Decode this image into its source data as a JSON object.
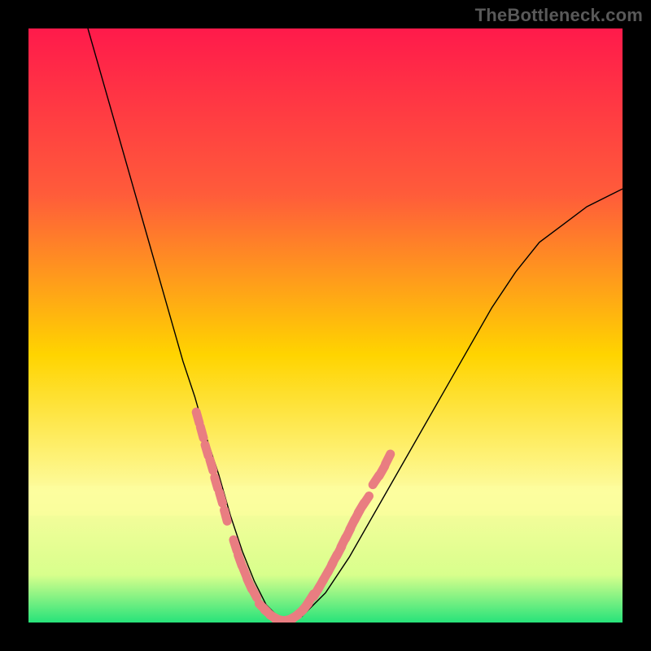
{
  "watermark": "TheBottleneck.com",
  "chart_data": {
    "type": "line",
    "title": "",
    "xlabel": "",
    "ylabel": "",
    "xlim": [
      0,
      100
    ],
    "ylim": [
      0,
      100
    ],
    "legend": false,
    "grid": false,
    "background_gradient": {
      "top_color": "#ff1a4b",
      "mid_color": "#ffd400",
      "lower_color": "#fdfc9f",
      "bottom_color": "#27e37a"
    },
    "series": [
      {
        "name": "bottleneck-curve",
        "color": "#000000",
        "width": 1.4,
        "x": [
          10,
          12,
          14,
          16,
          18,
          20,
          22,
          24,
          26,
          28,
          30,
          32,
          34,
          36,
          38,
          40,
          42,
          44,
          46,
          50,
          54,
          58,
          62,
          66,
          70,
          74,
          78,
          82,
          86,
          90,
          94,
          98,
          100
        ],
        "values": [
          100,
          93,
          86,
          79,
          72,
          65,
          58,
          51,
          44,
          38,
          31,
          25,
          18,
          12,
          7,
          3,
          1,
          0,
          1,
          5,
          11,
          18,
          25,
          32,
          39,
          46,
          53,
          59,
          64,
          67,
          70,
          72,
          73
        ]
      }
    ],
    "marker_segments": [
      {
        "name": "left-upper-dots",
        "color": "#e97d81",
        "x": [
          28.5,
          29.2,
          30.0,
          30.8,
          31.6,
          32.4,
          33.2
        ],
        "values": [
          34.5,
          32.0,
          29.0,
          26.5,
          23.5,
          21.0,
          18.0
        ]
      },
      {
        "name": "left-lower-dots",
        "color": "#e97d81",
        "x": [
          34.8,
          35.6,
          36.4,
          37.2,
          38.0
        ],
        "values": [
          13.0,
          10.5,
          8.5,
          6.5,
          5.0
        ]
      },
      {
        "name": "base-dots",
        "color": "#e97d81",
        "x": [
          39.5,
          40.5,
          41.5,
          42.5,
          43.5,
          44.5,
          45.5,
          46.5,
          47.0,
          47.5
        ],
        "values": [
          2.5,
          1.5,
          0.8,
          0.4,
          0.4,
          0.8,
          1.5,
          2.5,
          3.2,
          4.0
        ]
      },
      {
        "name": "right-dots",
        "color": "#e97d81",
        "x": [
          48.5,
          49.2,
          50.0,
          50.8,
          51.5,
          52.3,
          53.0,
          53.8,
          54.5,
          55.3,
          56.0,
          56.8
        ],
        "values": [
          5.2,
          6.4,
          7.8,
          9.2,
          10.6,
          12.0,
          13.5,
          15.0,
          16.5,
          18.0,
          19.3,
          20.5
        ]
      },
      {
        "name": "right-upper-dots",
        "color": "#e97d81",
        "x": [
          58.5,
          59.5,
          60.5
        ],
        "values": [
          24.0,
          25.5,
          27.5
        ]
      }
    ]
  }
}
